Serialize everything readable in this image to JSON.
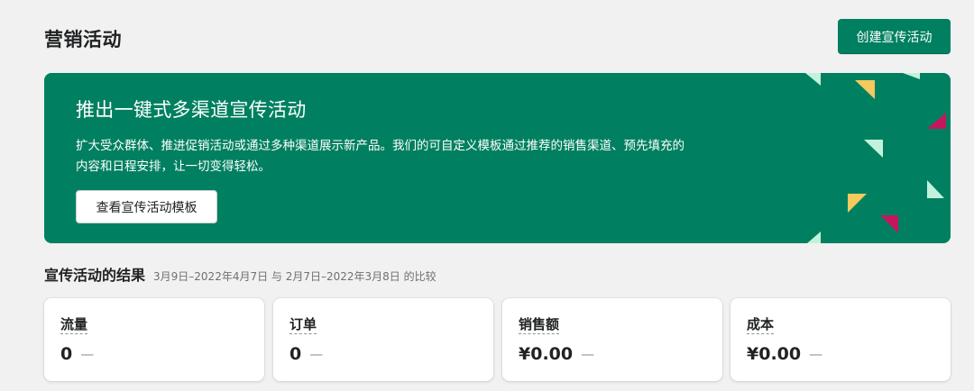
{
  "header": {
    "title": "营销活动",
    "create_button_label": "创建宣传活动"
  },
  "banner": {
    "title": "推出一键式多渠道宣传活动",
    "description_line1": "扩大受众群体、推进促销活动或通过多种渠道展示新产品。我们的可自定义模板通过推荐的销售渠道、预先填充的",
    "description_line2": "内容和日程安排，让一切变得轻松。",
    "button_label": "查看宣传活动模板",
    "colors": {
      "background": "#008060",
      "yellow": "#f4c95d",
      "red": "#c2185b",
      "mint": "#c3f2dc"
    }
  },
  "results": {
    "title": "宣传活动的结果",
    "date_range": "3月9日–2022年4月7日 与 2月7日–2022年3月8日 的比较"
  },
  "metrics": [
    {
      "label": "流量",
      "value": "0",
      "delta": "—"
    },
    {
      "label": "订单",
      "value": "0",
      "delta": "—"
    },
    {
      "label": "销售额",
      "value": "¥0.00",
      "delta": "—"
    },
    {
      "label": "成本",
      "value": "¥0.00",
      "delta": "—"
    }
  ],
  "colors": {
    "primary": "#008060",
    "page_background": "#f1f1f1",
    "text": "#202223",
    "subdued_text": "#6d7175"
  }
}
